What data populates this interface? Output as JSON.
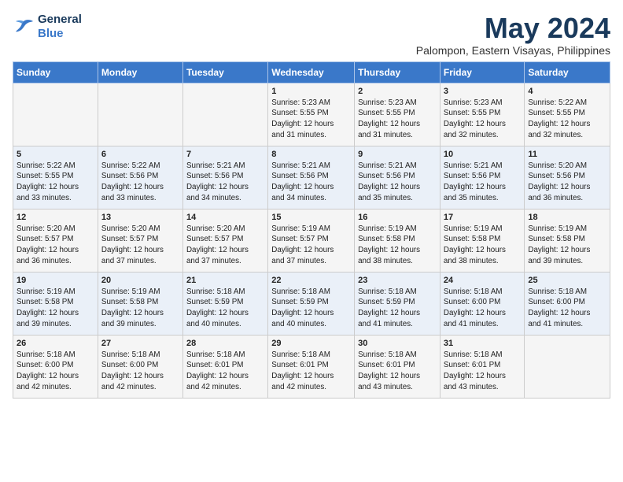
{
  "header": {
    "logo_line1": "General",
    "logo_line2": "Blue",
    "month": "May 2024",
    "location": "Palompon, Eastern Visayas, Philippines"
  },
  "weekdays": [
    "Sunday",
    "Monday",
    "Tuesday",
    "Wednesday",
    "Thursday",
    "Friday",
    "Saturday"
  ],
  "weeks": [
    [
      {
        "day": "",
        "info": ""
      },
      {
        "day": "",
        "info": ""
      },
      {
        "day": "",
        "info": ""
      },
      {
        "day": "1",
        "info": "Sunrise: 5:23 AM\nSunset: 5:55 PM\nDaylight: 12 hours\nand 31 minutes."
      },
      {
        "day": "2",
        "info": "Sunrise: 5:23 AM\nSunset: 5:55 PM\nDaylight: 12 hours\nand 31 minutes."
      },
      {
        "day": "3",
        "info": "Sunrise: 5:23 AM\nSunset: 5:55 PM\nDaylight: 12 hours\nand 32 minutes."
      },
      {
        "day": "4",
        "info": "Sunrise: 5:22 AM\nSunset: 5:55 PM\nDaylight: 12 hours\nand 32 minutes."
      }
    ],
    [
      {
        "day": "5",
        "info": "Sunrise: 5:22 AM\nSunset: 5:55 PM\nDaylight: 12 hours\nand 33 minutes."
      },
      {
        "day": "6",
        "info": "Sunrise: 5:22 AM\nSunset: 5:56 PM\nDaylight: 12 hours\nand 33 minutes."
      },
      {
        "day": "7",
        "info": "Sunrise: 5:21 AM\nSunset: 5:56 PM\nDaylight: 12 hours\nand 34 minutes."
      },
      {
        "day": "8",
        "info": "Sunrise: 5:21 AM\nSunset: 5:56 PM\nDaylight: 12 hours\nand 34 minutes."
      },
      {
        "day": "9",
        "info": "Sunrise: 5:21 AM\nSunset: 5:56 PM\nDaylight: 12 hours\nand 35 minutes."
      },
      {
        "day": "10",
        "info": "Sunrise: 5:21 AM\nSunset: 5:56 PM\nDaylight: 12 hours\nand 35 minutes."
      },
      {
        "day": "11",
        "info": "Sunrise: 5:20 AM\nSunset: 5:56 PM\nDaylight: 12 hours\nand 36 minutes."
      }
    ],
    [
      {
        "day": "12",
        "info": "Sunrise: 5:20 AM\nSunset: 5:57 PM\nDaylight: 12 hours\nand 36 minutes."
      },
      {
        "day": "13",
        "info": "Sunrise: 5:20 AM\nSunset: 5:57 PM\nDaylight: 12 hours\nand 37 minutes."
      },
      {
        "day": "14",
        "info": "Sunrise: 5:20 AM\nSunset: 5:57 PM\nDaylight: 12 hours\nand 37 minutes."
      },
      {
        "day": "15",
        "info": "Sunrise: 5:19 AM\nSunset: 5:57 PM\nDaylight: 12 hours\nand 37 minutes."
      },
      {
        "day": "16",
        "info": "Sunrise: 5:19 AM\nSunset: 5:58 PM\nDaylight: 12 hours\nand 38 minutes."
      },
      {
        "day": "17",
        "info": "Sunrise: 5:19 AM\nSunset: 5:58 PM\nDaylight: 12 hours\nand 38 minutes."
      },
      {
        "day": "18",
        "info": "Sunrise: 5:19 AM\nSunset: 5:58 PM\nDaylight: 12 hours\nand 39 minutes."
      }
    ],
    [
      {
        "day": "19",
        "info": "Sunrise: 5:19 AM\nSunset: 5:58 PM\nDaylight: 12 hours\nand 39 minutes."
      },
      {
        "day": "20",
        "info": "Sunrise: 5:19 AM\nSunset: 5:58 PM\nDaylight: 12 hours\nand 39 minutes."
      },
      {
        "day": "21",
        "info": "Sunrise: 5:18 AM\nSunset: 5:59 PM\nDaylight: 12 hours\nand 40 minutes."
      },
      {
        "day": "22",
        "info": "Sunrise: 5:18 AM\nSunset: 5:59 PM\nDaylight: 12 hours\nand 40 minutes."
      },
      {
        "day": "23",
        "info": "Sunrise: 5:18 AM\nSunset: 5:59 PM\nDaylight: 12 hours\nand 41 minutes."
      },
      {
        "day": "24",
        "info": "Sunrise: 5:18 AM\nSunset: 6:00 PM\nDaylight: 12 hours\nand 41 minutes."
      },
      {
        "day": "25",
        "info": "Sunrise: 5:18 AM\nSunset: 6:00 PM\nDaylight: 12 hours\nand 41 minutes."
      }
    ],
    [
      {
        "day": "26",
        "info": "Sunrise: 5:18 AM\nSunset: 6:00 PM\nDaylight: 12 hours\nand 42 minutes."
      },
      {
        "day": "27",
        "info": "Sunrise: 5:18 AM\nSunset: 6:00 PM\nDaylight: 12 hours\nand 42 minutes."
      },
      {
        "day": "28",
        "info": "Sunrise: 5:18 AM\nSunset: 6:01 PM\nDaylight: 12 hours\nand 42 minutes."
      },
      {
        "day": "29",
        "info": "Sunrise: 5:18 AM\nSunset: 6:01 PM\nDaylight: 12 hours\nand 42 minutes."
      },
      {
        "day": "30",
        "info": "Sunrise: 5:18 AM\nSunset: 6:01 PM\nDaylight: 12 hours\nand 43 minutes."
      },
      {
        "day": "31",
        "info": "Sunrise: 5:18 AM\nSunset: 6:01 PM\nDaylight: 12 hours\nand 43 minutes."
      },
      {
        "day": "",
        "info": ""
      }
    ]
  ]
}
